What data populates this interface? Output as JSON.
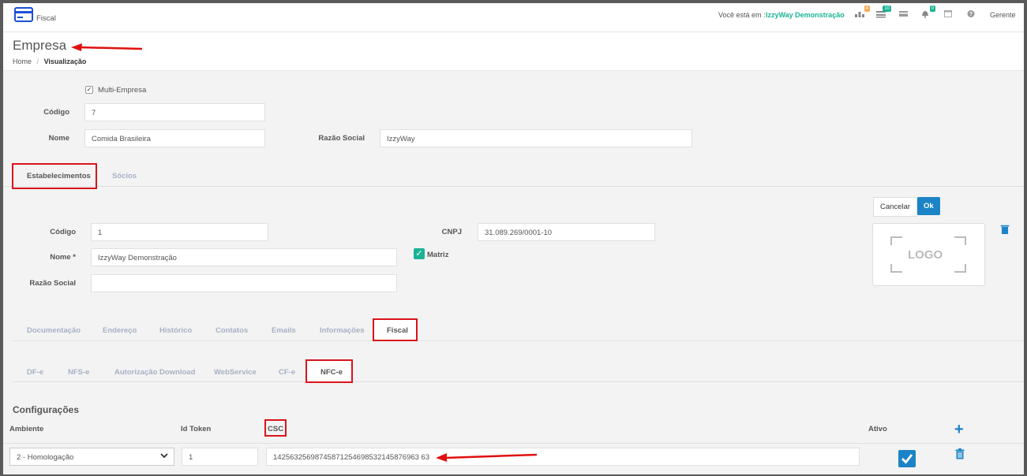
{
  "topbar": {
    "module": "Fiscal",
    "location_prefix": "Você está em :",
    "location": "IzzyWay Demonstração",
    "badges": [
      "4",
      "10",
      "",
      "0"
    ],
    "user": "Gerente",
    "icons": [
      "sitemap-icon",
      "list-icon",
      "card-icon",
      "bell-icon",
      "calendar-icon",
      "help-icon"
    ]
  },
  "page": {
    "title": "Empresa",
    "breadcrumb_home": "Home",
    "breadcrumb_sep": "/",
    "breadcrumb_current": "Visualização"
  },
  "empresa": {
    "multi_empresa_label": "Multi-Empresa",
    "codigo_label": "Código",
    "codigo": "7",
    "nome_label": "Nome",
    "nome": "Comida Brasileira",
    "razao_label": "Razão Social",
    "razao": "IzzyWay"
  },
  "main_tabs": [
    "Estabelecimentos",
    "Sócios"
  ],
  "estab": {
    "codigo_label": "Código",
    "codigo": "1",
    "cnpj_label": "CNPJ",
    "cnpj": "31.089.269/0001-10",
    "nome_label": "Nome *",
    "nome": "IzzyWay Demonstração",
    "matriz_label": "Matriz",
    "razao_label": "Razão Social",
    "razao": "",
    "cancel_label": "Cancelar",
    "ok_label": "Ok",
    "logo_text": "LOGO"
  },
  "sub_tabs": [
    "Documentação",
    "Endereço",
    "Histórico",
    "Contatos",
    "Emails",
    "Informações",
    "Fiscal"
  ],
  "fiscal_tabs": [
    "DF-e",
    "NFS-e",
    "Autorização Download",
    "WebService",
    "CF-e",
    "NFC-e"
  ],
  "config": {
    "title": "Configurações",
    "col_ambiente": "Ambiente",
    "col_token": "Id Token",
    "col_csc": "CSC",
    "col_ativo": "Ativo",
    "ambiente": "2 - Homologação",
    "token": "1",
    "csc": "14256325698745871254698532145876963 63",
    "ativo": true
  },
  "colors": {
    "accent": "#1ab394",
    "primary": "#1c84c6",
    "highlight": "#d9141a"
  }
}
